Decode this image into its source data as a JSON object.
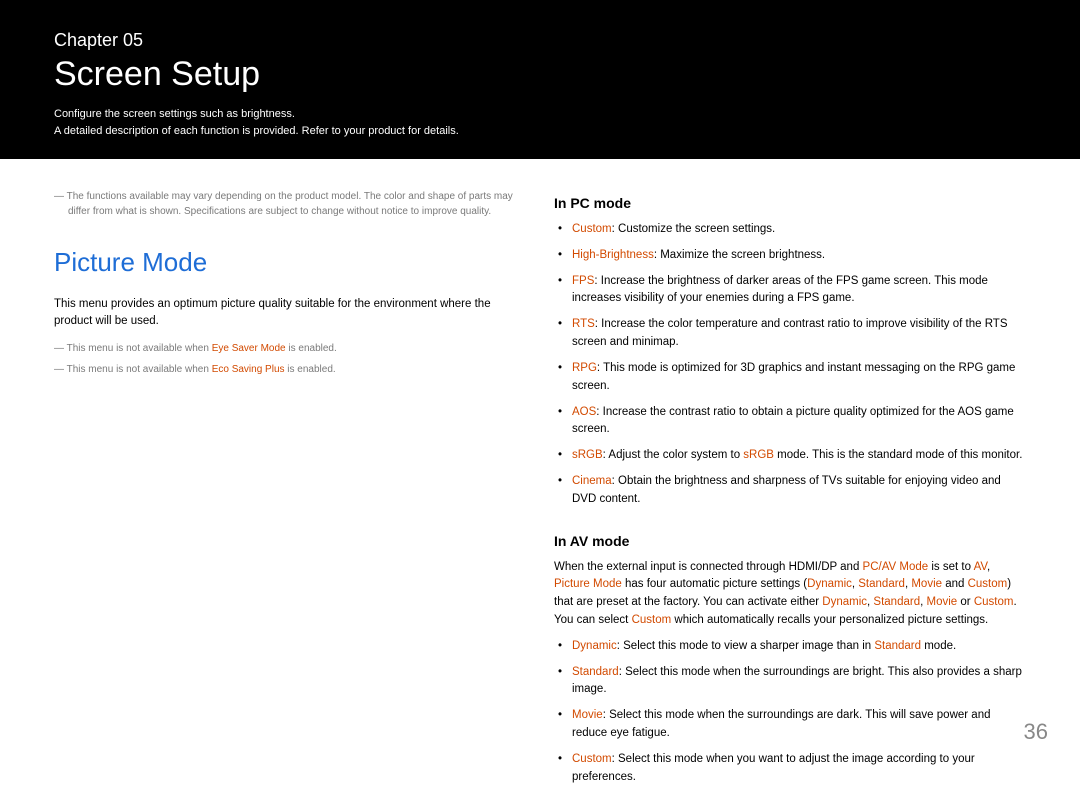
{
  "header": {
    "chapter_label": "Chapter 05",
    "chapter_title": "Screen Setup",
    "sub1": "Configure the screen settings such as brightness.",
    "sub2": "A detailed description of each function is provided. Refer to your product for details."
  },
  "left": {
    "top_note": "The functions available may vary depending on the product model. The color and shape of parts may differ from what is shown. Specifications are subject to change without notice to improve quality.",
    "section_title": "Picture Mode",
    "intro": "This menu provides an optimum picture quality suitable for the environment where the product will be used.",
    "note1_pre": "This menu is not available when ",
    "note1_hl": "Eye Saver Mode",
    "note1_post": " is enabled.",
    "note2_pre": "This menu is not available when ",
    "note2_hl": "Eco Saving Plus",
    "note2_post": " is enabled."
  },
  "pc": {
    "heading": "In PC mode",
    "items": [
      {
        "k": "Custom",
        "v": ": Customize the screen settings."
      },
      {
        "k": "High-Brightness",
        "v": ": Maximize the screen brightness."
      },
      {
        "k": "FPS",
        "v": ": Increase the brightness of darker areas of the FPS game screen. This mode increases visibility of your enemies during a FPS game."
      },
      {
        "k": "RTS",
        "v": ": Increase the color temperature and contrast ratio to improve visibility of the RTS screen and minimap."
      },
      {
        "k": "RPG",
        "v": ": This mode is optimized for 3D graphics and instant messaging on the RPG game screen."
      },
      {
        "k": "AOS",
        "v": ": Increase the contrast ratio to obtain a picture quality optimized for the AOS game screen."
      }
    ],
    "srgb_k": "sRGB",
    "srgb_pre": ": Adjust the color system to ",
    "srgb_mid": "sRGB",
    "srgb_post": " mode. This is the standard mode of this monitor.",
    "cinema_k": "Cinema",
    "cinema_v": ": Obtain the brightness and sharpness of TVs suitable for enjoying video and DVD content."
  },
  "av": {
    "heading": "In AV mode",
    "p_a": "When the external input is connected through HDMI/DP and ",
    "p_b": "PC/AV Mode",
    "p_c": " is set to ",
    "p_d": "AV",
    "p_e": ", ",
    "p_f": "Picture Mode",
    "p_g": " has four automatic picture settings (",
    "p_h": "Dynamic",
    "p_i": ", ",
    "p_j": "Standard",
    "p_k": ", ",
    "p_l": "Movie",
    "p_m": " and ",
    "p_n": "Custom",
    "p_o": ") that are preset at the factory. You can activate either ",
    "p_p": "Dynamic",
    "p_q": ", ",
    "p_r": "Standard",
    "p_s": ", ",
    "p_t": "Movie",
    "p_u": " or ",
    "p_v": "Custom",
    "p_w": ". You can select ",
    "p_x": "Custom",
    "p_y": " which automatically recalls your personalized picture settings.",
    "dyn_k": "Dynamic",
    "dyn_pre": ": Select this mode to view a sharper image than in ",
    "dyn_mid": "Standard",
    "dyn_post": " mode.",
    "std_k": "Standard",
    "std_v": ": Select this mode when the surroundings are bright. This also provides a sharp image.",
    "mov_k": "Movie",
    "mov_v": ": Select this mode when the surroundings are dark. This will save power and reduce eye fatigue.",
    "cus_k": "Custom",
    "cus_v": ": Select this mode when you want to adjust the image according to your preferences."
  },
  "page_number": "36"
}
